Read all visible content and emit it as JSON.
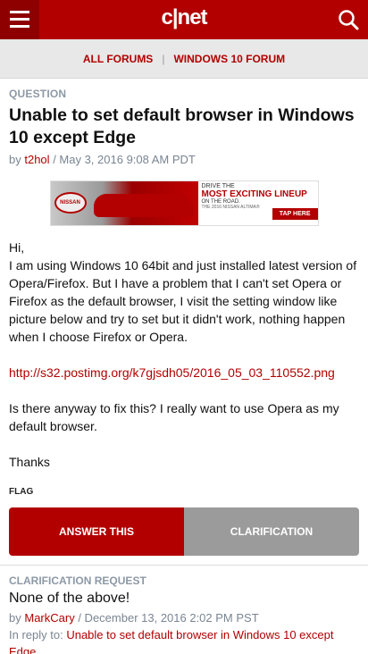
{
  "header": {
    "logo_text": "c|net"
  },
  "forum_nav": {
    "all_forums": "ALL FORUMS",
    "separator": "|",
    "current_forum": "WINDOWS 10 FORUM"
  },
  "question": {
    "label": "QUESTION",
    "title": "Unable to set default browser in Windows 10 except Edge",
    "by": "by",
    "author": "t2hol",
    "date": "/ May 3, 2016 9:08 AM PDT",
    "paragraphs": [
      "Hi,\nI am using Windows 10 64bit and just installed latest version of Opera/Firefox. But I have a problem that I can't set Opera or Firefox as the default browser, I visit the setting window like picture below and try to set but it didn't work, nothing happen when I choose Firefox or Opera.",
      "Is there anyway to fix this? I really want to use Opera as my default browser.",
      "Thanks"
    ],
    "link": "http://s32.postimg.org/k7gjsdh05/2016_05_03_110552.png",
    "flag": "FLAG"
  },
  "ad": {
    "brand": "NISSAN",
    "line1": "DRIVE THE",
    "line2": "MOST EXCITING LINEUP",
    "line3": "ON THE ROAD.",
    "line4": "THE 2016 NISSAN ALTIMA®",
    "cta": "TAP HERE"
  },
  "actions": {
    "answer": "ANSWER THIS",
    "clarify": "CLARIFICATION"
  },
  "clarification": {
    "label": "CLARIFICATION REQUEST",
    "title": "None of the above!",
    "by": "by",
    "author": "MarkCary",
    "date": "/ December 13, 2016 2:02 PM PST",
    "reply_prefix": "In reply to:",
    "reply_link": "Unable to set default browser in Windows 10 except Edge"
  },
  "colors": {
    "brand_red": "#b20000",
    "muted_gray": "#8d99a6",
    "button_gray": "#9b9b9b"
  },
  "icons": [
    "hamburger-menu-icon",
    "search-icon"
  ]
}
